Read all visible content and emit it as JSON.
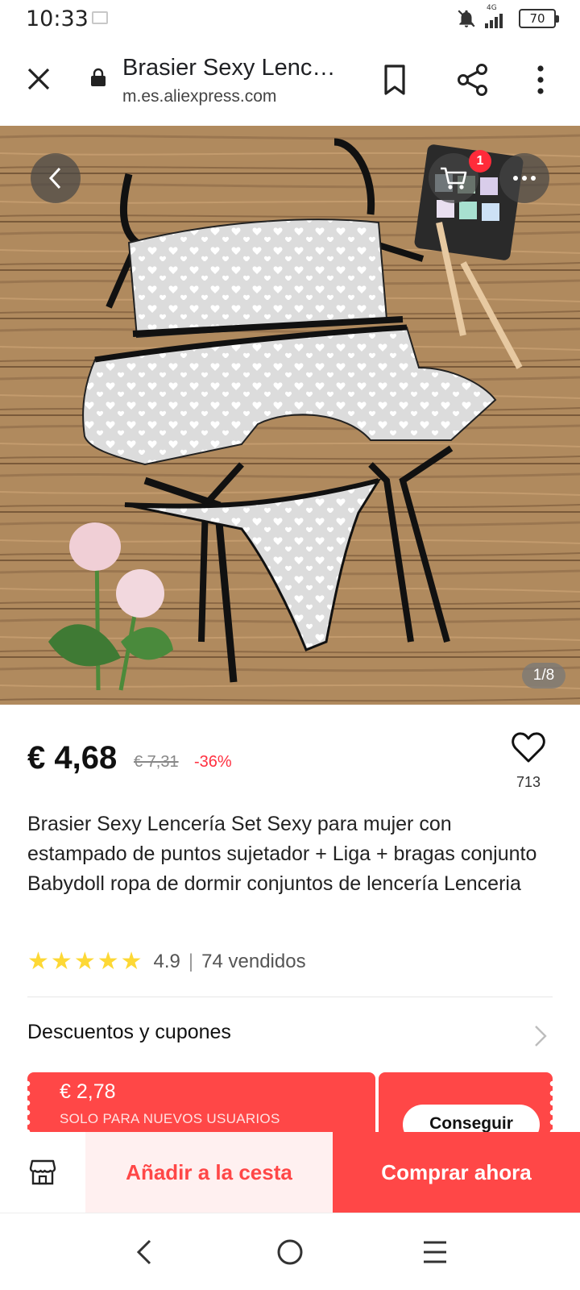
{
  "status_bar": {
    "time": "10:33",
    "network": "4G",
    "battery": "70"
  },
  "browser": {
    "title": "Brasier Sexy Lenc…",
    "url": "m.es.aliexpress.com"
  },
  "gallery": {
    "counter": "1/8",
    "cart_badge": "1"
  },
  "product": {
    "price": "€ 4,68",
    "old_price": "€ 7,31",
    "discount": "-36%",
    "wishlist_count": "713",
    "title": "Brasier Sexy Lencería Set Sexy para mujer con estampado de puntos sujetador + Liga + bragas conjunto Babydoll ropa de dormir conjuntos de lencería Lenceria",
    "rating_stars": 5,
    "rating_text": "4.9",
    "separator": "|",
    "sold_text": "74 vendidos"
  },
  "coupons": {
    "heading": "Descuentos y cupones",
    "amount": "€ 2,78",
    "note": "SOLO PARA NUEVOS USUARIOS",
    "button": "Conseguir"
  },
  "actions": {
    "add_to_cart": "Añadir a la cesta",
    "buy_now": "Comprar ahora"
  },
  "icons": {
    "close": "close-icon",
    "lock": "lock-icon",
    "bookmark": "bookmark-icon",
    "share": "share-icon",
    "menu": "more-vert-icon",
    "back": "chevron-left-icon",
    "cart": "cart-icon",
    "more": "more-horiz-icon",
    "heart": "heart-icon",
    "store": "store-icon"
  },
  "colors": {
    "accent": "#ff4747",
    "accent_light": "#fff0f0",
    "discount": "#ff3040",
    "star": "#fdd835"
  }
}
